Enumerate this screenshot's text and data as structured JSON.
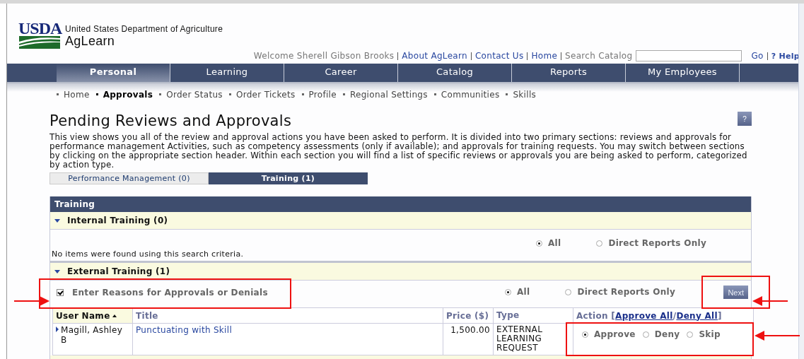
{
  "logo": {
    "mark": "USDA",
    "agency": "United States Department of Agriculture",
    "product": "AgLearn"
  },
  "top_links": {
    "welcome": "Welcome Sherell Gibson Brooks",
    "links": [
      "About AgLearn",
      "Contact Us",
      "Home"
    ],
    "search_label": "Search Catalog",
    "go": "Go",
    "help": "? Help"
  },
  "nav": [
    {
      "label": "Personal",
      "selected": true
    },
    {
      "label": "Learning",
      "selected": false
    },
    {
      "label": "Career",
      "selected": false
    },
    {
      "label": "Catalog",
      "selected": false
    },
    {
      "label": "Reports",
      "selected": false
    },
    {
      "label": "My Employees",
      "selected": false
    }
  ],
  "subnav": [
    {
      "label": "Home",
      "selected": false
    },
    {
      "label": "Approvals",
      "selected": true
    },
    {
      "label": "Order Status",
      "selected": false
    },
    {
      "label": "Order Tickets",
      "selected": false
    },
    {
      "label": "Profile",
      "selected": false
    },
    {
      "label": "Regional Settings",
      "selected": false
    },
    {
      "label": "Communities",
      "selected": false
    },
    {
      "label": "Skills",
      "selected": false
    }
  ],
  "page": {
    "title": "Pending Reviews and Approvals",
    "help_button": "?",
    "description": "This view shows you all of the review and approval actions you have been asked to perform. It is divided into two primary sections: reviews and approvals for performance management Activities, such as competency assessments (only if available); and approvals for training requests. You may switch between sections by clicking on the appropriate section header. Within each section you will find a list of specific reviews or approvals you are being asked to perform, categorized by action type."
  },
  "section_tabs": [
    {
      "label": "Performance Management (0)",
      "selected": false
    },
    {
      "label": "Training (1)",
      "selected": true
    }
  ],
  "panel": {
    "title": "Training",
    "internal": {
      "title": "Internal Training (0)",
      "expanded": true,
      "filters": [
        {
          "label": "All",
          "selected": true
        },
        {
          "label": "Direct Reports Only",
          "selected": false
        }
      ],
      "empty_message": "No items were found using this search criteria."
    },
    "external": {
      "title": "External Training (1)",
      "expanded": true,
      "reasons_checkbox": {
        "label": "Enter Reasons for Approvals or Denials",
        "checked": true
      },
      "filters": [
        {
          "label": "All",
          "selected": true
        },
        {
          "label": "Direct Reports Only",
          "selected": false
        }
      ],
      "next_button": "Next",
      "columns": [
        {
          "kind": "sorted",
          "label": "User Name"
        },
        {
          "kind": "plain",
          "label": "Title"
        },
        {
          "kind": "plain",
          "label": "Price ($)"
        },
        {
          "kind": "plain",
          "label": "Type"
        },
        {
          "kind": "action",
          "label": "Action [",
          "links": [
            "Approve All",
            "Deny All"
          ],
          "separator": "/",
          "close": "]"
        }
      ],
      "rows": [
        {
          "user": "Magill, Ashley B",
          "title": "Punctuating with Skill",
          "price": "1,500.00",
          "type": "EXTERNAL LEARNING REQUEST",
          "actions": [
            {
              "label": "Approve",
              "selected": true
            },
            {
              "label": "Deny",
              "selected": false
            },
            {
              "label": "Skip",
              "selected": false
            }
          ]
        }
      ]
    }
  }
}
